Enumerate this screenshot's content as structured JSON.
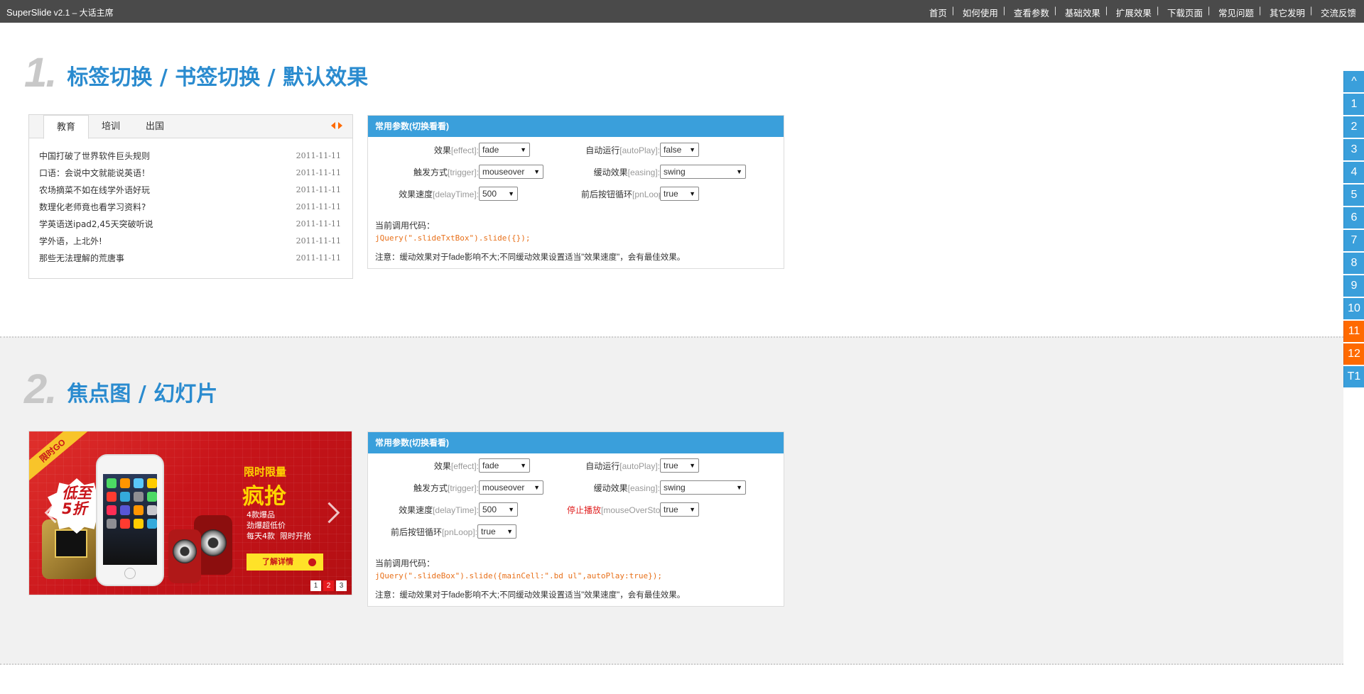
{
  "topbar": {
    "brand": "SuperSlide",
    "version": "v2.1 – 大话主席",
    "nav": [
      "首页",
      "如何使用",
      "查看参数",
      "基础效果",
      "扩展效果",
      "下载页面",
      "常见问题",
      "其它发明",
      "交流反馈"
    ]
  },
  "side_index": [
    "^",
    "1",
    "2",
    "3",
    "4",
    "5",
    "6",
    "7",
    "8",
    "9",
    "10",
    "11",
    "12",
    "T1"
  ],
  "section1": {
    "num": "1.",
    "title": "标签切换 / 书签切换 / 默认效果",
    "tabs": [
      "教育",
      "培训",
      "出国"
    ],
    "list": [
      {
        "text": "中国打破了世界软件巨头规则",
        "date": "2011-11-11"
      },
      {
        "text": "口语：会说中文就能说英语！",
        "date": "2011-11-11"
      },
      {
        "text": "农场摘菜不如在线学外语好玩",
        "date": "2011-11-11"
      },
      {
        "text": "数理化老师竟也看学习资料?",
        "date": "2011-11-11"
      },
      {
        "text": "学英语送ipad2,45天突破听说",
        "date": "2011-11-11"
      },
      {
        "text": "学外语，上北外!",
        "date": "2011-11-11"
      },
      {
        "text": "那些无法理解的荒唐事",
        "date": "2011-11-11"
      }
    ],
    "panel": {
      "header": "常用参数(切换看看)",
      "effect_label": "效果",
      "effect_en": "[effect]:",
      "effect_value": "fade",
      "autoplay_label": "自动运行",
      "autoplay_en": "[autoPlay]:",
      "autoplay_value": "false",
      "trigger_label": "触发方式",
      "trigger_en": "[trigger]:",
      "trigger_value": "mouseover",
      "easing_label": "缓动效果",
      "easing_en": "[easing]:",
      "easing_value": "swing",
      "delay_label": "效果速度",
      "delay_en": "[delayTime]:",
      "delay_value": "500",
      "pnloop_label": "前后按钮循环",
      "pnloop_en": "[pnLoop]:",
      "pnloop_value": "true",
      "code_label": "当前调用代码：",
      "code": "jQuery(\".slideTxtBox\").slide({});",
      "note": "注意：缓动效果对于fade影响不大;不同缓动效果设置适当\"效果速度\"，会有最佳效果。"
    }
  },
  "section2": {
    "num": "2.",
    "title": "焦点图 / 幻灯片",
    "banner": {
      "ribbon": "限时GO",
      "badge": "低至\n5折",
      "promo_small": "限时限量",
      "promo_big": "疯抢",
      "promo_lines": "4款爆品\n劲爆超低价\n每天4款  限时开抢",
      "detail_btn": "了解详情",
      "pager": [
        "1",
        "2",
        "3"
      ],
      "active_page": 2
    },
    "panel": {
      "header": "常用参数(切换看看)",
      "effect_label": "效果",
      "effect_en": "[effect]:",
      "effect_value": "fade",
      "autoplay_label": "自动运行",
      "autoplay_en": "[autoPlay]:",
      "autoplay_value": "true",
      "trigger_label": "触发方式",
      "trigger_en": "[trigger]:",
      "trigger_value": "mouseover",
      "easing_label": "缓动效果",
      "easing_en": "[easing]:",
      "easing_value": "swing",
      "delay_label": "效果速度",
      "delay_en": "[delayTime]:",
      "delay_value": "500",
      "stop_label": "停止播放",
      "stop_en": "[mouseOverStop]:",
      "stop_value": "true",
      "pnloop_label": "前后按钮循环",
      "pnloop_en": "[pnLoop]:",
      "pnloop_value": "true",
      "code_label": "当前调用代码：",
      "code": "jQuery(\".slideBox\").slide({mainCell:\".bd ul\",autoPlay:true});",
      "note": "注意：缓动效果对于fade影响不大;不同缓动效果设置适当\"效果速度\"，会有最佳效果。"
    }
  },
  "colors": {
    "topbar": "#4a4a4a",
    "accent_blue": "#3a9fdb",
    "accent_orange": "#ff6a00",
    "title_blue": "#2a8bcf",
    "code_orange": "#e8701a"
  }
}
